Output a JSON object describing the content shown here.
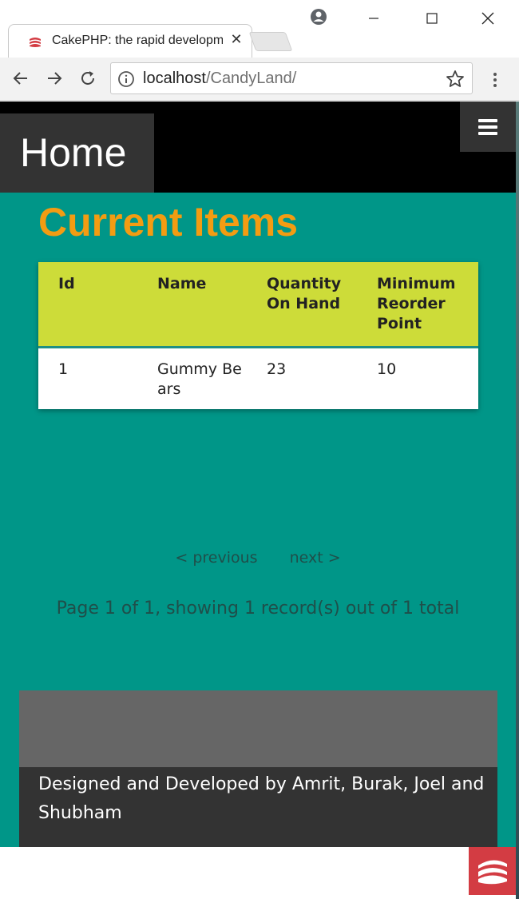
{
  "browser": {
    "tab_title": "CakePHP: the rapid development php framework",
    "url_host": "localhost",
    "url_path": "/CandyLand/",
    "close_glyph": "✕"
  },
  "nav": {
    "home_label": "Home",
    "menu_icon": "hamburger-icon"
  },
  "main": {
    "heading": "Current Items",
    "table": {
      "headers": {
        "id": "Id",
        "name": "Name",
        "quantity": "Quantity On Hand",
        "minimum": "Minimum Reorder Point"
      },
      "rows": [
        {
          "id": "1",
          "name": "Gummy Bears",
          "quantity": "23",
          "minimum": "10"
        }
      ]
    },
    "pagination": {
      "previous": "< previous",
      "next": "next >",
      "counter": "Page 1 of 1, showing 1 record(s) out of 1 total"
    }
  },
  "footer": {
    "credits": "Designed and Developed by Amrit, Burak, Joel and Shubham"
  },
  "colors": {
    "page_bg": "#009688",
    "heading": "#f39c12",
    "table_header": "#cddc39",
    "nav_bg": "#000000",
    "home_box": "#333333",
    "footer_top": "#666666",
    "footer_bottom": "#333333",
    "cake_red": "#d33c43"
  }
}
